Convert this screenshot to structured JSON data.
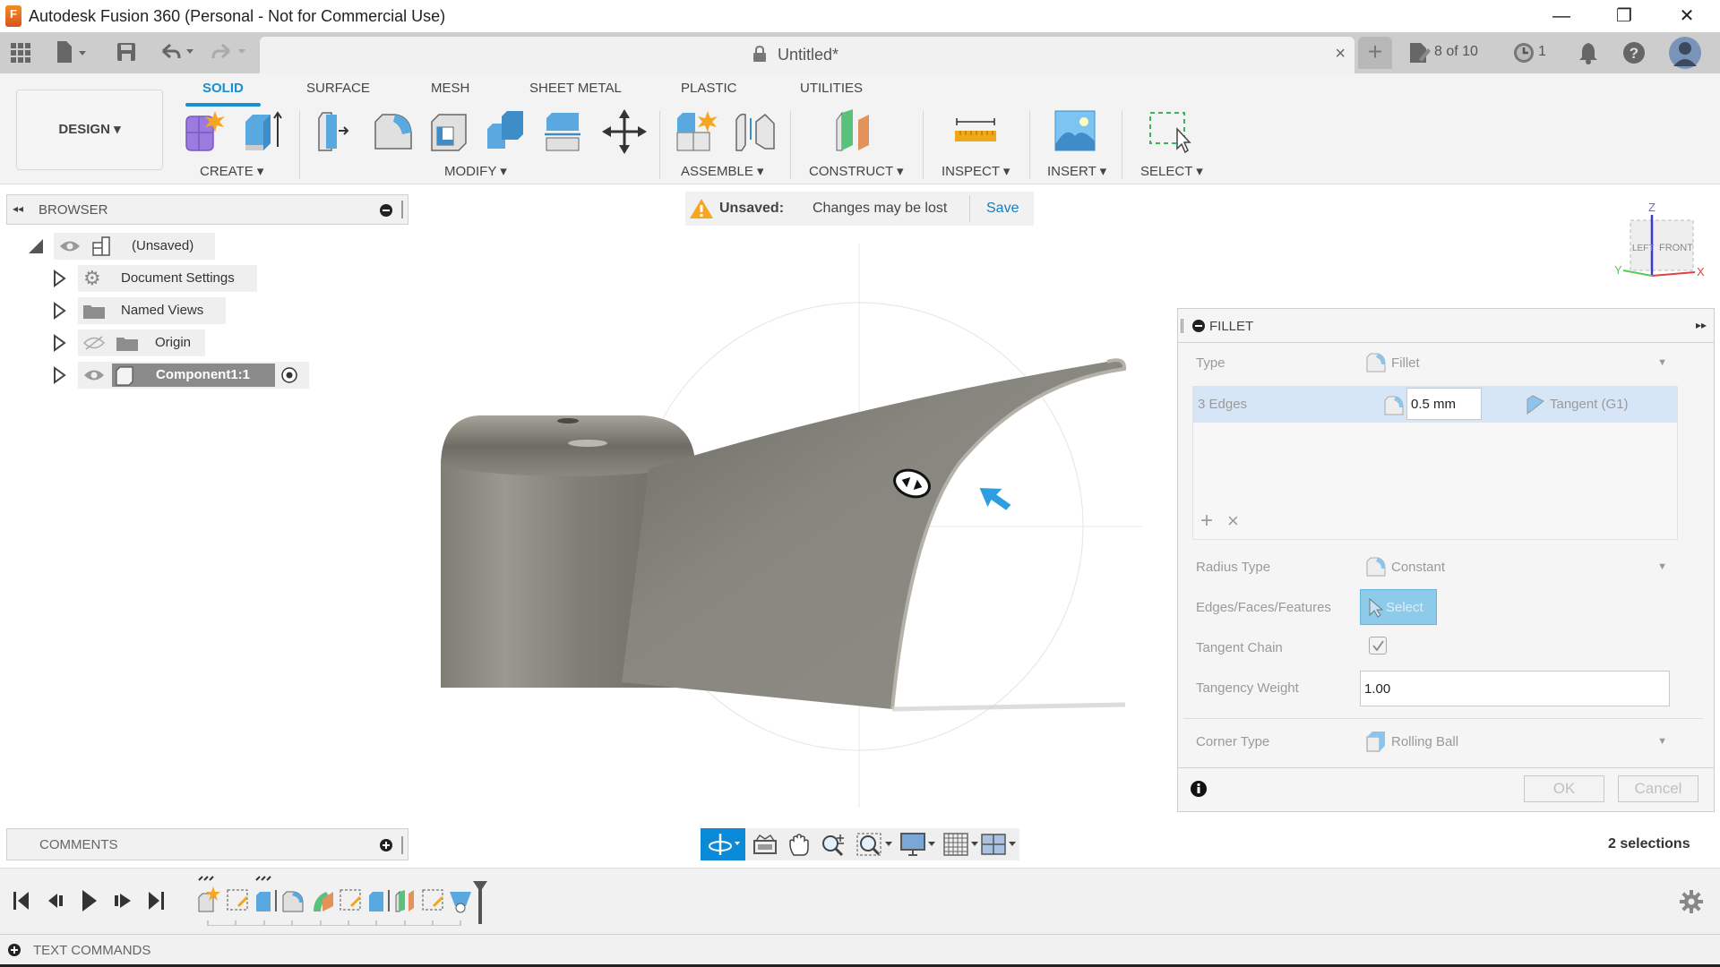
{
  "window": {
    "title": "Autodesk Fusion 360 (Personal - Not for Commercial Use)",
    "logo_letter": "F",
    "controls": {
      "minimize": "—",
      "restore": "❐",
      "close": "✕"
    }
  },
  "tabbar": {
    "document_title": "Untitled*",
    "close_glyph": "×",
    "new_tab_glyph": "+",
    "jobs_label": "8 of 10",
    "history_count": "1"
  },
  "ribbon": {
    "workspace": "DESIGN ▾",
    "tabs": [
      {
        "label": "SOLID",
        "active": true
      },
      {
        "label": "SURFACE",
        "active": false
      },
      {
        "label": "MESH",
        "active": false
      },
      {
        "label": "SHEET METAL",
        "active": false
      },
      {
        "label": "PLASTIC",
        "active": false
      },
      {
        "label": "UTILITIES",
        "active": false
      }
    ],
    "groups": {
      "create": "CREATE ▾",
      "modify": "MODIFY ▾",
      "assemble": "ASSEMBLE ▾",
      "construct": "CONSTRUCT ▾",
      "inspect": "INSPECT ▾",
      "insert": "INSERT ▾",
      "select": "SELECT ▾"
    },
    "accent": "#1a8fd0"
  },
  "browser": {
    "title": "BROWSER",
    "root": "(Unsaved)",
    "items": [
      {
        "label": "Document Settings",
        "icon": "gear-icon"
      },
      {
        "label": "Named Views",
        "icon": "folder-icon"
      },
      {
        "label": "Origin",
        "icon": "folder-icon",
        "hidden": true
      },
      {
        "label": "Component1:1",
        "icon": "component-icon",
        "selected": true
      }
    ]
  },
  "unsaved_bar": {
    "label": "Unsaved:",
    "message": "Changes may be lost",
    "save": "Save"
  },
  "viewcube": {
    "z": "Z",
    "x": "X",
    "y": "Y",
    "front": "FRONT",
    "left": "LEFT"
  },
  "fillet": {
    "title": "FILLET",
    "type_label": "Type",
    "type_value": "Fillet",
    "edge_set": {
      "name": "3 Edges",
      "radius": "0.5 mm",
      "continuity": "Tangent (G1)"
    },
    "add_glyph": "+",
    "remove_glyph": "×",
    "radius_type_label": "Radius Type",
    "radius_type_value": "Constant",
    "edges_label": "Edges/Faces/Features",
    "select_button": "Select",
    "tangent_chain_label": "Tangent Chain",
    "tangent_chain_checked": true,
    "tangency_weight_label": "Tangency Weight",
    "tangency_weight_value": "1.00",
    "corner_type_label": "Corner Type",
    "corner_type_value": "Rolling Ball",
    "ok": "OK",
    "cancel": "Cancel"
  },
  "status": {
    "selections": "2 selections"
  },
  "comments": {
    "title": "COMMENTS"
  },
  "text_commands": {
    "title": "TEXT COMMANDS"
  },
  "timeline": {
    "features": [
      "sketch",
      "sketch-edit",
      "extrude",
      "fillet",
      "sweep",
      "sketch-edit",
      "extrude",
      "plane",
      "sketch-edit",
      "loft"
    ]
  }
}
